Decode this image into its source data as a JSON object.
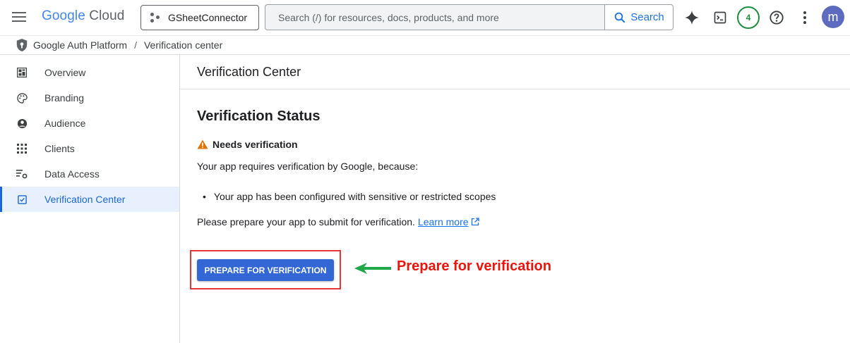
{
  "header": {
    "logo_google": "Google",
    "logo_cloud": "Cloud",
    "project_name": "GSheetConnector",
    "search_placeholder": "Search (/) for resources, docs, products, and more",
    "search_button": "Search",
    "notification_count": "4",
    "avatar_initial": "m",
    "icons": [
      "menu-icon",
      "gemini-icon",
      "terminal-icon",
      "help-icon",
      "more-vert-icon",
      "search-icon"
    ]
  },
  "breadcrumb": {
    "root": "Google Auth Platform",
    "separator": "/",
    "current": "Verification center"
  },
  "sidebar": {
    "items": [
      {
        "label": "Overview",
        "icon": "dashboard-icon"
      },
      {
        "label": "Branding",
        "icon": "palette-icon"
      },
      {
        "label": "Audience",
        "icon": "account-circle-icon"
      },
      {
        "label": "Clients",
        "icon": "grid-icon"
      },
      {
        "label": "Data Access",
        "icon": "data-settings-icon"
      },
      {
        "label": "Verification Center",
        "icon": "verification-icon",
        "active": true
      }
    ]
  },
  "main": {
    "page_title": "Verification Center",
    "section_title": "Verification Status",
    "status_label": "Needs verification",
    "requirement_text": "Your app requires verification by Google, because:",
    "reasons": [
      "Your app has been configured with sensitive or restricted scopes"
    ],
    "prepare_text": "Please prepare your app to submit for verification.",
    "learn_more": "Learn more",
    "primary_button": "PREPARE FOR VERIFICATION",
    "annotation_text": "Prepare for verification"
  },
  "colors": {
    "accent": "#1a73e8",
    "button": "#3367d6",
    "warning": "#e37400",
    "annotation_red": "#e8160c",
    "arrow_green": "#1ea84a"
  }
}
